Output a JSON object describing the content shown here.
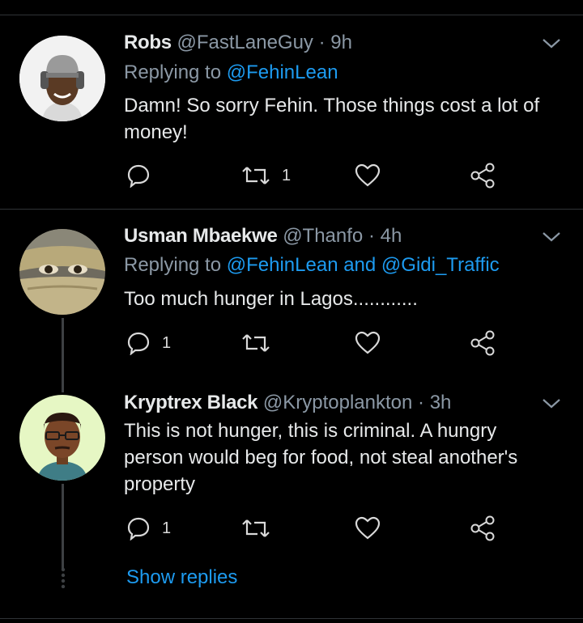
{
  "replies": [
    {
      "name": "Robs",
      "handle": "@FastLaneGuy",
      "separator": "·",
      "time": "9h",
      "replying_prefix": "Replying to ",
      "replying_to": "@FehinLean",
      "text": "Damn! So sorry Fehin. Those things cost a lot of money!",
      "reply_count": "",
      "retweet_count": "1",
      "avatar_icon": "avatar-headphones-man"
    },
    {
      "name": "Usman Mbaekwe",
      "handle": "@Thanfo",
      "separator": "·",
      "time": "4h",
      "replying_prefix": "Replying to ",
      "replying_to": "@FehinLean and @Gidi_Traffic",
      "text": "Too much hunger in Lagos............",
      "reply_count": "1",
      "retweet_count": "",
      "avatar_icon": "avatar-veiled-face"
    },
    {
      "name": "Kryptrex Black",
      "handle": "@Kryptoplankton",
      "separator": "·",
      "time": "3h",
      "text": "This is not hunger, this is criminal. A hungry person would beg for food, not steal another's property",
      "reply_count": "1",
      "retweet_count": "",
      "avatar_icon": "avatar-bitmoji-man"
    }
  ],
  "show_replies_label": "Show replies",
  "colors": {
    "background": "#000000",
    "accent": "#1d9bf0",
    "name": "#e7e9ea",
    "meta": "#8b98a5",
    "divider": "#2f3336"
  }
}
